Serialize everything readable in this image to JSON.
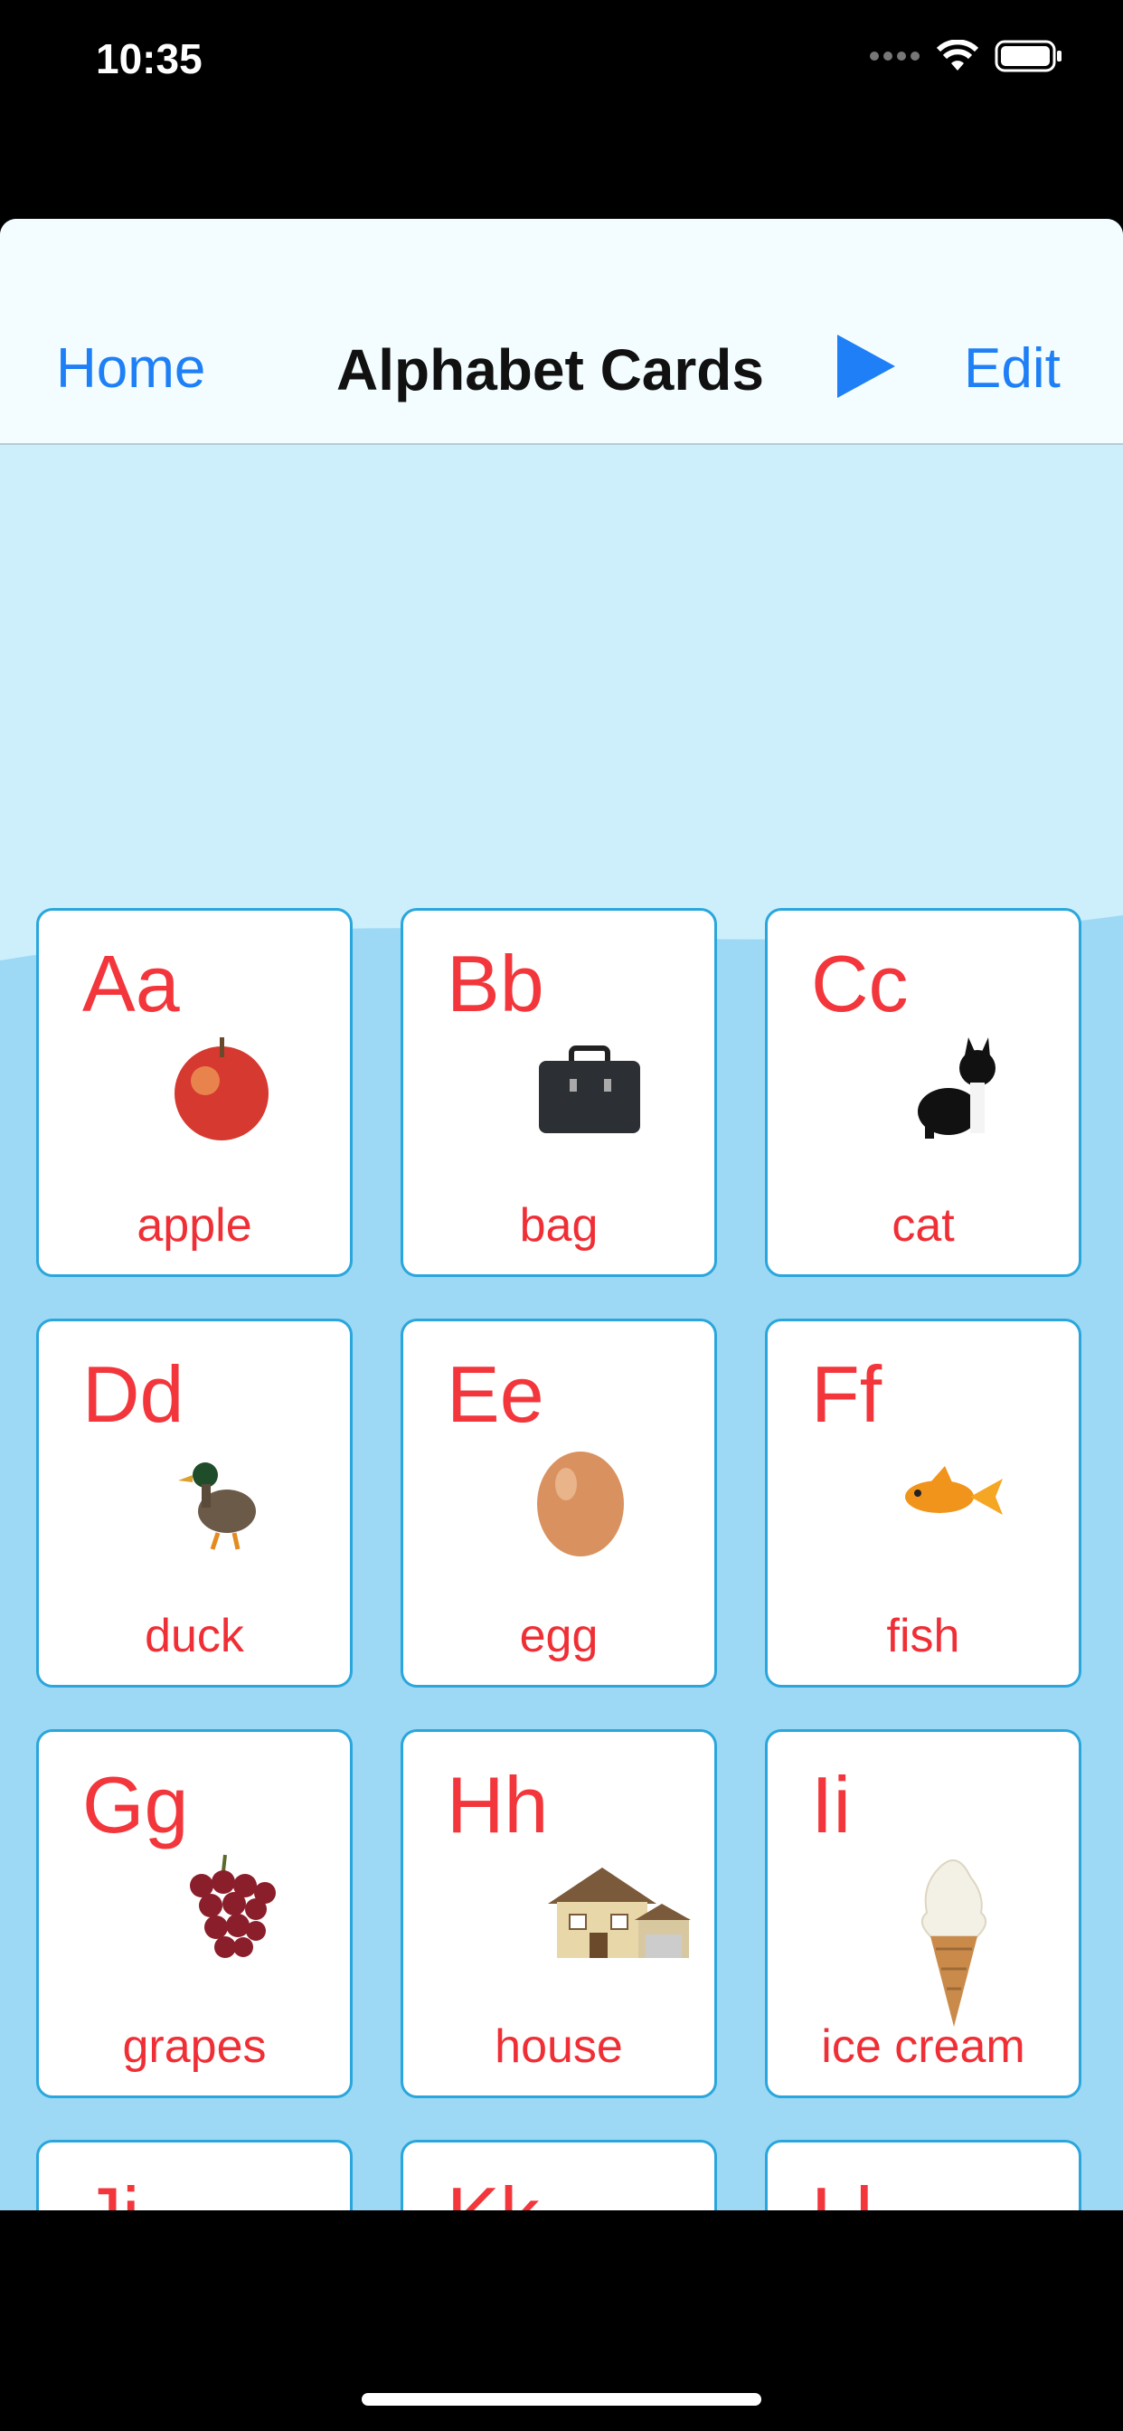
{
  "status_bar": {
    "time": "10:35"
  },
  "nav": {
    "home_label": "Home",
    "title": "Alphabet Cards",
    "edit_label": "Edit"
  },
  "cards": [
    {
      "letters": "Aa",
      "word": "apple",
      "icon": "apple-icon"
    },
    {
      "letters": "Bb",
      "word": "bag",
      "icon": "bag-icon"
    },
    {
      "letters": "Cc",
      "word": "cat",
      "icon": "cat-icon"
    },
    {
      "letters": "Dd",
      "word": "duck",
      "icon": "duck-icon"
    },
    {
      "letters": "Ee",
      "word": "egg",
      "icon": "egg-icon"
    },
    {
      "letters": "Ff",
      "word": "fish",
      "icon": "fish-icon"
    },
    {
      "letters": "Gg",
      "word": "grapes",
      "icon": "grapes-icon"
    },
    {
      "letters": "Hh",
      "word": "house",
      "icon": "house-icon"
    },
    {
      "letters": "Ii",
      "word": "ice cream",
      "icon": "ice-cream-icon"
    },
    {
      "letters": "Jj",
      "word": "",
      "icon": "jellyfish-icon"
    },
    {
      "letters": "Kk",
      "word": "",
      "icon": "kite-icon"
    },
    {
      "letters": "Ll",
      "word": "",
      "icon": "lemon-icon"
    }
  ],
  "colors": {
    "accent": "#1e7ff6",
    "card_text": "#f2363b",
    "card_border": "#2aa6dc",
    "background": "#cdeffc"
  }
}
